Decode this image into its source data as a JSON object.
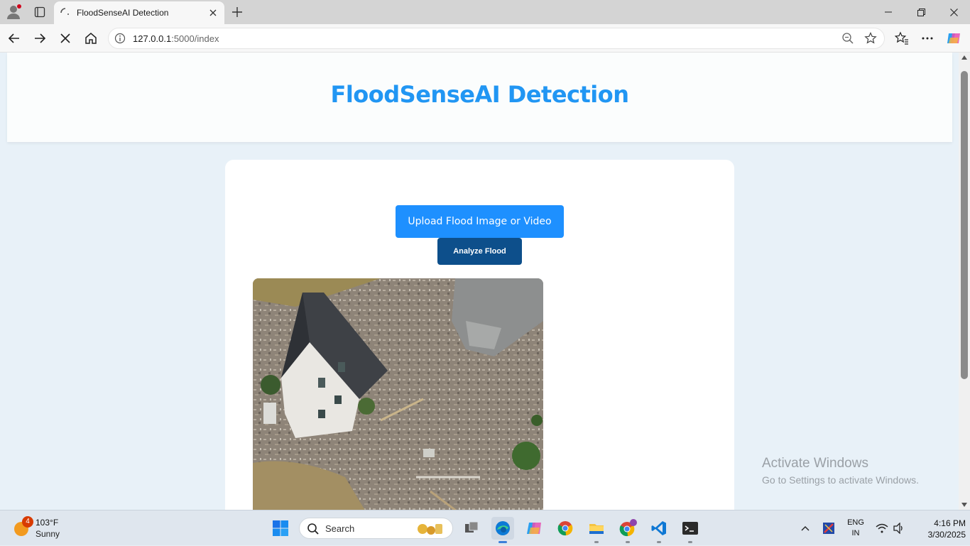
{
  "browser": {
    "tab_title": "FloodSenseAI Detection",
    "url_host": "127.0.0.1",
    "url_path": ":5000/index"
  },
  "page": {
    "heading": "FloodSenseAI Detection",
    "upload_label": "Upload Flood Image or Video",
    "analyze_label": "Analyze Flood"
  },
  "watermark": {
    "line1": "Activate Windows",
    "line2": "Go to Settings to activate Windows."
  },
  "taskbar": {
    "weather_badge": "4",
    "temperature": "103°F",
    "condition": "Sunny",
    "search_placeholder": "Search",
    "lang_top": "ENG",
    "lang_bottom": "IN",
    "time": "4:16 PM",
    "date": "3/30/2025"
  },
  "colors": {
    "accent": "#2196f3",
    "upload_button": "#1e90ff",
    "analyze_button": "#0d4f8b"
  }
}
